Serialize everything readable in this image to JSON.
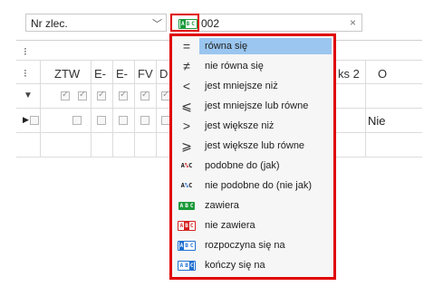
{
  "filter": {
    "field_label": "Nr zlec.",
    "value": "002",
    "clear_glyph": "×",
    "dropdown_glyph": "﹀"
  },
  "grid": {
    "headers": [
      "ZTW",
      "E-",
      "E-",
      "FV",
      "D",
      "ks 2",
      "O"
    ],
    "row_value": "Nie",
    "filter_glyph": "▼",
    "grip_glyph": "⁝"
  },
  "operators": [
    {
      "icon": "equals-icon",
      "glyph": "=",
      "label": "równa się",
      "selected": true
    },
    {
      "icon": "not-equal-icon",
      "glyph": "≠",
      "label": "nie równa się"
    },
    {
      "icon": "less-than-icon",
      "glyph": "<",
      "label": "jest mniejsze niż"
    },
    {
      "icon": "less-or-equal-icon",
      "glyph": "⩽",
      "label": "jest mniejsze lub równe"
    },
    {
      "icon": "greater-than-icon",
      "glyph": ">",
      "label": "jest większe niż"
    },
    {
      "icon": "greater-or-equal-icon",
      "glyph": "⩾",
      "label": "jest większe lub równe"
    },
    {
      "icon": "like-icon",
      "label": "podobne do (jak)"
    },
    {
      "icon": "not-like-icon",
      "label": "nie podobne do (nie jak)"
    },
    {
      "icon": "contains-icon",
      "label": "zawiera"
    },
    {
      "icon": "not-contains-icon",
      "label": "nie zawiera"
    },
    {
      "icon": "starts-with-icon",
      "label": "rozpoczyna się na"
    },
    {
      "icon": "ends-with-icon",
      "label": "kończy się na"
    }
  ],
  "colors": {
    "highlight": "#e00000",
    "selection": "#9ac6f0",
    "green": "#1a9a3a",
    "red": "#d42020",
    "blue": "#1f6fd0"
  }
}
